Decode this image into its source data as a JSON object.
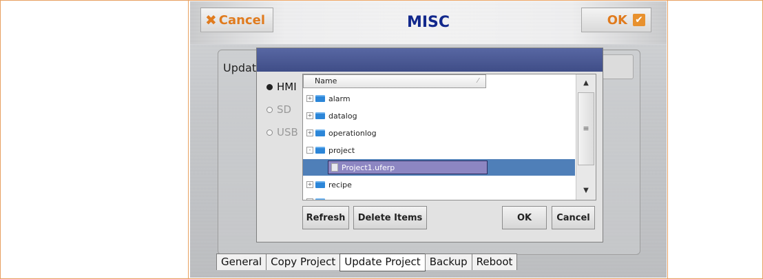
{
  "header": {
    "title": "MISC",
    "cancel_label": "Cancel",
    "ok_label": "OK"
  },
  "panel": {
    "label": "Update"
  },
  "dialog": {
    "sources": [
      {
        "label": "HMI",
        "selected": true
      },
      {
        "label": "SD",
        "selected": false
      },
      {
        "label": "USB",
        "selected": false
      }
    ],
    "column_header": "Name",
    "tree_items": [
      {
        "label": "alarm",
        "type": "folder",
        "expander": "+"
      },
      {
        "label": "datalog",
        "type": "folder",
        "expander": "+"
      },
      {
        "label": "operationlog",
        "type": "folder",
        "expander": "+"
      },
      {
        "label": "project",
        "type": "folder",
        "expander": "-"
      },
      {
        "label": "Project1.uferp",
        "type": "file",
        "selected": true
      },
      {
        "label": "recipe",
        "type": "folder",
        "expander": "+"
      }
    ],
    "buttons": {
      "refresh": "Refresh",
      "delete": "Delete Items",
      "ok": "OK",
      "cancel": "Cancel"
    }
  },
  "tabs": [
    {
      "label": "General",
      "active": false
    },
    {
      "label": "Copy Project",
      "active": false
    },
    {
      "label": "Update Project",
      "active": true
    },
    {
      "label": "Backup",
      "active": false
    },
    {
      "label": "Reboot",
      "active": false
    }
  ],
  "colors": {
    "accent": "#e07b1e",
    "title": "#12288c",
    "dialog_titlebar": "#4a5893",
    "selection": "#8d86c2"
  },
  "icons": [
    "close-x-icon",
    "checkbox-check-icon",
    "folder-icon",
    "file-icon",
    "scroll-up-icon",
    "scroll-down-icon"
  ]
}
